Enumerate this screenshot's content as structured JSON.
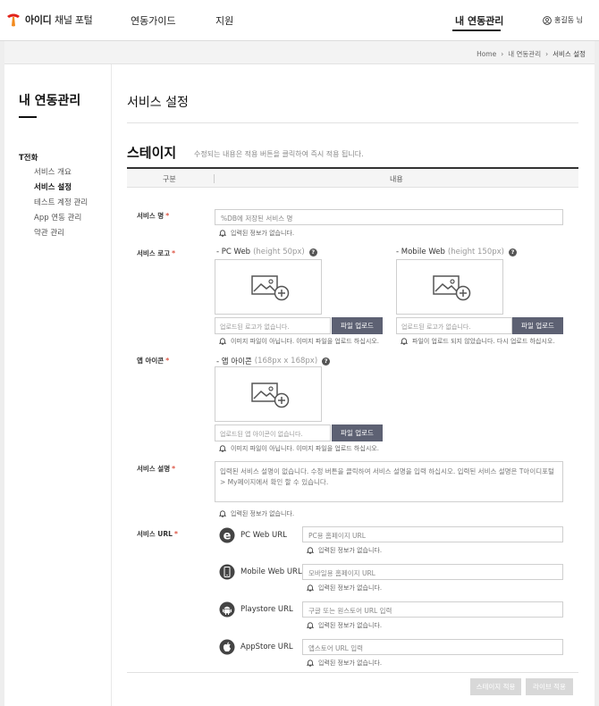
{
  "header": {
    "logo_brand": "아이디",
    "logo_sub": "채널 포털",
    "nav": [
      {
        "label": "연동가이드"
      },
      {
        "label": "지원"
      },
      {
        "label": "내 연동관리"
      }
    ],
    "user_name": "홍길동 님",
    "brand_color": "#e2231a"
  },
  "breadcrumb": [
    "Home",
    "내 연동관리",
    "서비스 설정"
  ],
  "sidebar": {
    "title": "내 연동관리",
    "group": "T전화",
    "items": [
      {
        "label": "서비스 개요"
      },
      {
        "label": "서비스 설정",
        "active": true
      },
      {
        "label": "테스트 계정 관리"
      },
      {
        "label": "App 연동 관리"
      },
      {
        "label": "약관 관리"
      }
    ]
  },
  "main": {
    "page_title": "서비스 설정",
    "section_title": "스테이지",
    "section_desc": "수정되는 내용은 적용 버튼을 클릭하여 즉시 적용 됩니다.",
    "table_head": {
      "col1": "구분",
      "col2": "내용"
    },
    "service_name": {
      "label": "서비스 명",
      "value": "%DB에 저장된 서비스 명",
      "hint": "입력된 정보가 없습니다."
    },
    "service_logo": {
      "label": "서비스 로고",
      "pc": {
        "title": "- PC Web",
        "size": "(height 50px)",
        "file_placeholder": "업로드된 로고가 없습니다.",
        "button": "파일 업로드",
        "hint": "이미지 파일이 아닙니다. 이미지 파일을 업로드 하십시오."
      },
      "mobile": {
        "title": "- Mobile Web",
        "size": "(height 150px)",
        "file_placeholder": "업로드된 로고가 없습니다.",
        "button": "파일 업로드",
        "hint": "파일이 업로드 되지 않았습니다. 다시 업로드 하십시오."
      }
    },
    "app_icon": {
      "label": "앱 아이콘",
      "title": "- 앱 아이콘",
      "size": "(168px x 168px)",
      "file_placeholder": "업로드된 앱 아이콘이 없습니다.",
      "button": "파일 업로드",
      "hint": "이미지 파일이 아닙니다. 이미지 파일을 업로드 하십시오."
    },
    "service_desc": {
      "label": "서비스 설명",
      "value": "입력된 서비스 설명이 없습니다. 수정 버튼을 클릭하여 서비스 설명을 입력 하십시오. 입력된 서비스 설명은 T아이디포털 > My페이지에서 확인 할 수 있습니다.",
      "hint": "입력된 정보가 없습니다."
    },
    "service_url": {
      "label": "서비스 URL",
      "rows": [
        {
          "name": "PC Web URL",
          "placeholder": "PC용 홈페이지 URL",
          "hint": "입력된 정보가 없습니다.",
          "icon": "ie-icon"
        },
        {
          "name": "Mobile Web URL",
          "placeholder": "모바일용 홈페이지 URL",
          "hint": "입력된 정보가 없습니다.",
          "icon": "mobile-icon"
        },
        {
          "name": "Playstore URL",
          "placeholder": "구글 또는 원스토어 URL 입력",
          "hint": "입력된 정보가 없습니다.",
          "icon": "android-icon"
        },
        {
          "name": "AppStore URL",
          "placeholder": "앱스토어 URL 입력",
          "hint": "입력된 정보가 없습니다.",
          "icon": "apple-icon"
        }
      ]
    },
    "actions": {
      "stage_apply": "스테이지 적용",
      "live_apply": "라이브 적용"
    }
  }
}
